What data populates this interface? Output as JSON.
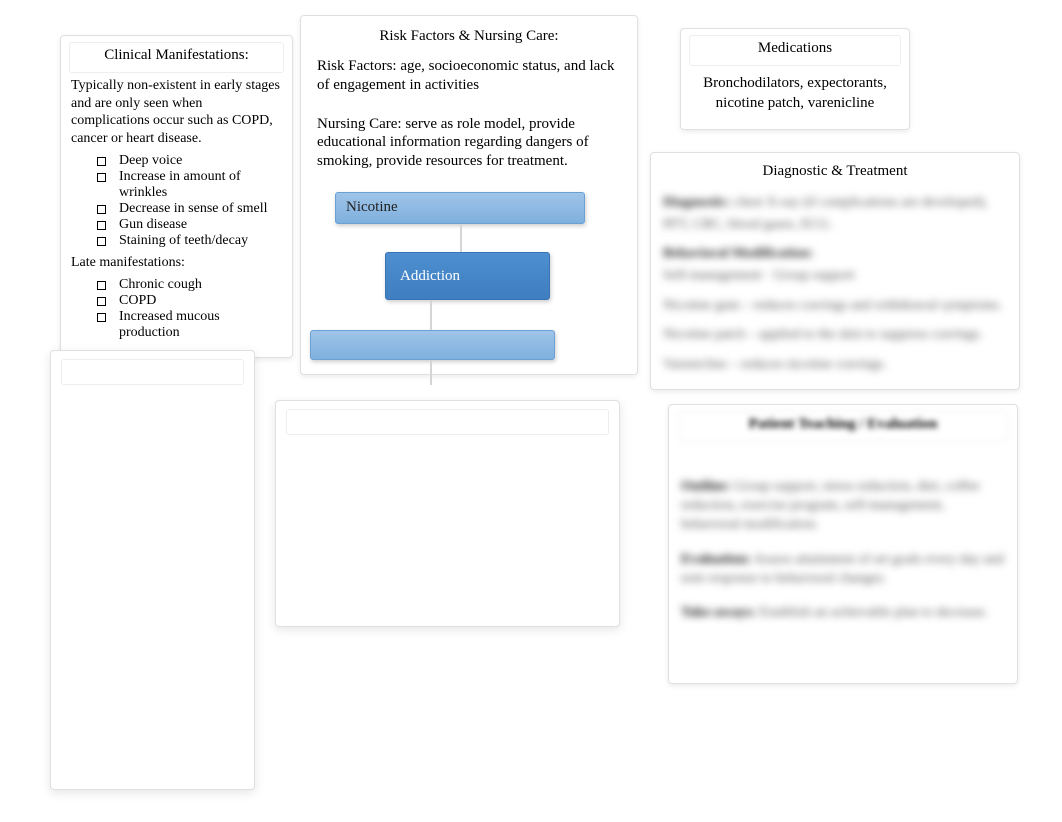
{
  "clinical": {
    "title": "Clinical Manifestations:",
    "intro": "Typically non-existent in early stages and are only seen when complications occur such as COPD, cancer or heart disease.",
    "early_items": [
      "Deep voice",
      "Increase in amount of wrinkles",
      "Decrease in sense of smell",
      "Gun disease",
      "Staining of teeth/decay"
    ],
    "late_label": "Late manifestations:",
    "late_items": [
      "Chronic cough",
      "COPD",
      "Increased mucous production"
    ]
  },
  "risk": {
    "title": "Risk Factors & Nursing Care:",
    "risk_label": "Risk Factors:",
    "risk_text": "age, socioeconomic status, and lack of engagement in activities",
    "care_label": "Nursing Care:",
    "care_text": "serve as role model, provide educational information regarding dangers of smoking, provide resources for treatment."
  },
  "bubbles": {
    "nicotine": "Nicotine",
    "addiction": "Addiction"
  },
  "meds": {
    "title": "Medications",
    "body_line1": "Bronchodilators, expectorants,",
    "body_line2": "nicotine patch, varenicline"
  },
  "diag": {
    "title": "Diagnostic & Treatment",
    "lines": [
      {
        "head": "Diagnostic:",
        "text": "chest X-ray (if complications are developed), PFT, CBC, blood gases, ECG."
      },
      {
        "head": "Behavioral Modification:",
        "text": "Self-management  ·  Group support"
      },
      {
        "head": "",
        "text": "Nicotine gum – reduces cravings and withdrawal symptoms."
      },
      {
        "head": "",
        "text": "Nicotine patch – applied to the skin to suppress cravings."
      },
      {
        "head": "",
        "text": "Varenicline – reduces nicotine cravings."
      }
    ]
  },
  "patho": {
    "title": "Patient Teaching / Evaluation",
    "lines": [
      {
        "head": "Outline:",
        "text": "Group support, stress reduction, diet, coffee reduction, exercise program, self-management, behavioral modification."
      },
      {
        "head": "Evaluation:",
        "text": "Assess attainment of set goals every day and note response to behavioral changes."
      },
      {
        "head": "Take-aways:",
        "text": "Establish an achievable plan to decrease."
      }
    ]
  }
}
